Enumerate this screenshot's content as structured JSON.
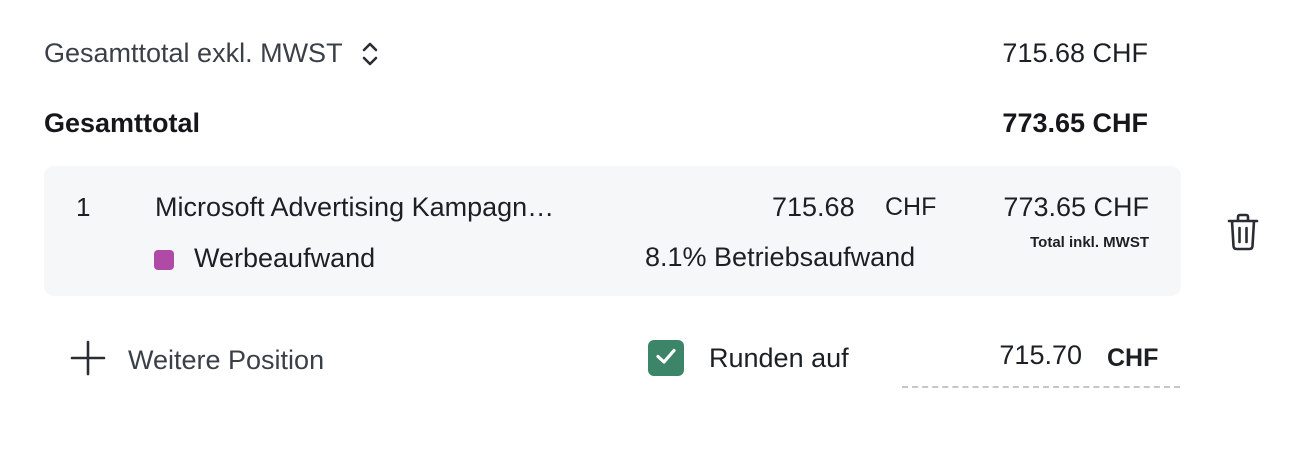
{
  "summary": {
    "net_label": "Gesamttotal exkl. MWST",
    "net_amount": "715.68 CHF",
    "gross_label": "Gesamttotal",
    "gross_amount": "773.65 CHF"
  },
  "position": {
    "number": "1",
    "title": "Microsoft Advertising Kampagn…",
    "category": "Werbeaufwand",
    "category_color": "#b04aa7",
    "net_value": "715.68",
    "net_currency": "CHF",
    "expense_type": "8.1% Betriebsaufwand",
    "gross_amount": "773.65 CHF",
    "gross_note": "Total inkl. MWST"
  },
  "actions": {
    "add_position_label": "Weitere Position",
    "round_label": "Runden auf",
    "round_checked": true,
    "round_value": "715.70",
    "round_currency": "CHF"
  },
  "colors": {
    "checkbox_green": "#3d8568",
    "card_bg": "#f6f7f9"
  },
  "icons": {
    "sort": "chevron-up-down-icon",
    "delete": "trash-icon",
    "add": "plus-icon",
    "check": "checkmark-icon"
  }
}
